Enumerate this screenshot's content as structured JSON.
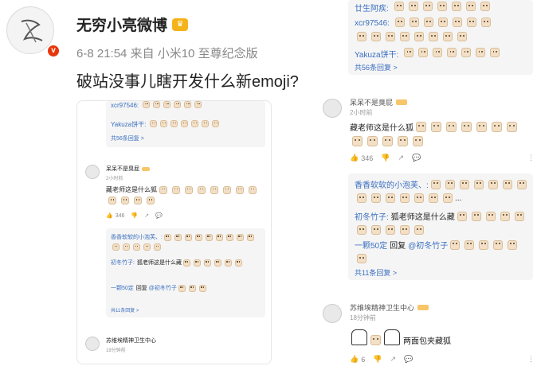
{
  "post": {
    "author": "无穷小亮微博",
    "meta": "6-8 21:54  来自 小米10 至尊纪念版",
    "text": "破站没事儿瞎开发什么新emoji?"
  },
  "comments": {
    "top_replies": [
      {
        "name": "廿生阿疾:",
        "emoji_count": 11
      },
      {
        "name": "xcr97546:",
        "emoji_count": 16
      },
      {
        "name": "Yakuza饼干:",
        "emoji_count": 7
      }
    ],
    "top_more": "共56条回复 >",
    "comment1": {
      "user": "呆呆不是臭屁",
      "time": "2小时前",
      "text": "藏老师这是什么狐",
      "emoji_count": 12,
      "likes": "346",
      "replies": [
        {
          "name": "香香软软的小泡芙、:",
          "text": "",
          "emoji_count": 19,
          "suffix": "..."
        },
        {
          "name": "初冬竹子:",
          "text": "狐老师这是什么藏",
          "emoji_count": 6
        },
        {
          "name": "一颗50定",
          "text": "回复",
          "mention": "@初冬竹子",
          "emoji_count": 6
        }
      ],
      "more": "共11条回复 >"
    },
    "comment2": {
      "user": "苏维埃精神卫生中心",
      "time": "18分钟前",
      "text": "两面包夹藏狐",
      "likes": "6"
    }
  },
  "colors": {
    "link": "#3a6fc0",
    "reply_bg": "#f5f5f5",
    "level_badge": "#f7c66a"
  }
}
